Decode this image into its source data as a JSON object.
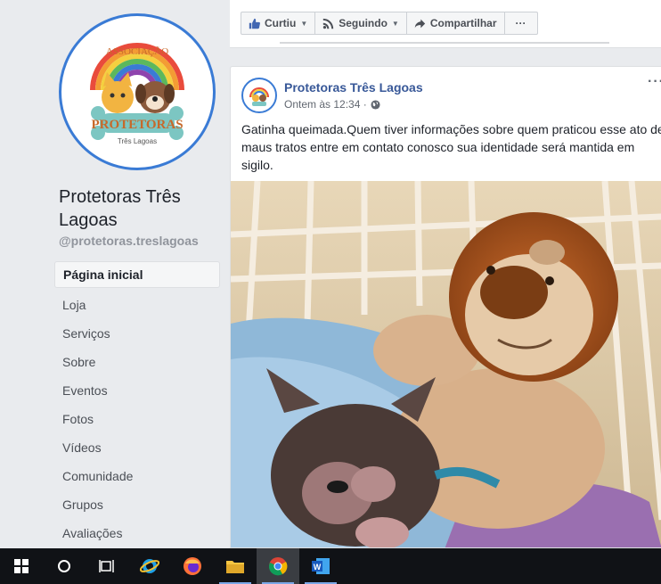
{
  "page": {
    "name": "Protetoras Três Lagoas",
    "handle": "@protetoras.treslagoas",
    "logo_text": {
      "arc": "ASSOCIAÇÃO",
      "main": "PROTETORAS",
      "sub": "Três Lagoas"
    }
  },
  "sidebar": {
    "items": [
      {
        "label": "Página inicial",
        "active": true
      },
      {
        "label": "Loja"
      },
      {
        "label": "Serviços"
      },
      {
        "label": "Sobre"
      },
      {
        "label": "Eventos"
      },
      {
        "label": "Fotos"
      },
      {
        "label": "Vídeos"
      },
      {
        "label": "Comunidade"
      },
      {
        "label": "Grupos"
      },
      {
        "label": "Avaliações"
      }
    ]
  },
  "actions": {
    "like_label": "Curtiu",
    "follow_label": "Seguindo",
    "share_label": "Compartilhar",
    "more_label": "···"
  },
  "post": {
    "author": "Protetoras Três Lagoas",
    "time": "Ontem às 12:34 ·",
    "menu": "···",
    "text": "Gatinha queimada.Quem tiver informações sobre quem praticou esse ato de maus tratos entre em contato conosco sua identidade será mantida em sigilo.",
    "photo_icon": "kitten-with-plush-lion-photo"
  },
  "taskbar": {
    "apps": [
      "windows-start-icon",
      "search-icon",
      "task-view-icon",
      "internet-explorer-icon",
      "firefox-icon",
      "file-explorer-icon",
      "chrome-icon",
      "word-icon"
    ]
  },
  "colors": {
    "link": "#385898",
    "accent": "#3a7bd5",
    "background": "#e9ebee",
    "taskbar": "#101216"
  }
}
